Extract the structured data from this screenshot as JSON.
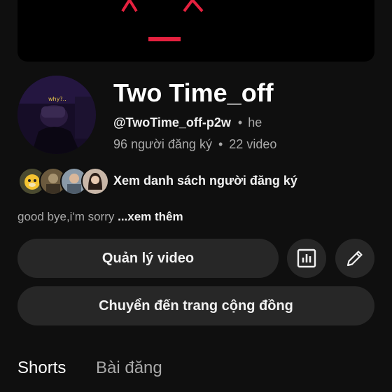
{
  "channel": {
    "name": "Two Time_off",
    "handle": "@TwoTime_off-p2w",
    "handle_suffix": "he",
    "subscribers": "96 người đăng ký",
    "videos": "22 video",
    "separator": "•",
    "avatar_caption": "why?.."
  },
  "subscribers_preview": {
    "link": "Xem danh sách người đăng ký",
    "avatar_icons": [
      "duck-avatar-icon",
      "sepia-avatar-icon",
      "person-avatar-icon",
      "woman-avatar-icon"
    ]
  },
  "description": {
    "text": "good bye,i'm sorry",
    "more": "...xem thêm"
  },
  "buttons": {
    "manage": "Quản lý video",
    "community": "Chuyển đến trang cộng đồng",
    "stats_icon": "analytics-icon",
    "edit_icon": "pencil-icon"
  },
  "tabs": [
    {
      "label": "Shorts",
      "active": true
    },
    {
      "label": "Bài đăng",
      "active": false
    }
  ],
  "colors": {
    "background": "#0f0f0f",
    "button": "#272727",
    "banner": "#000000",
    "banner_accent": "#e5213f",
    "muted_text": "#aaaaaa"
  }
}
